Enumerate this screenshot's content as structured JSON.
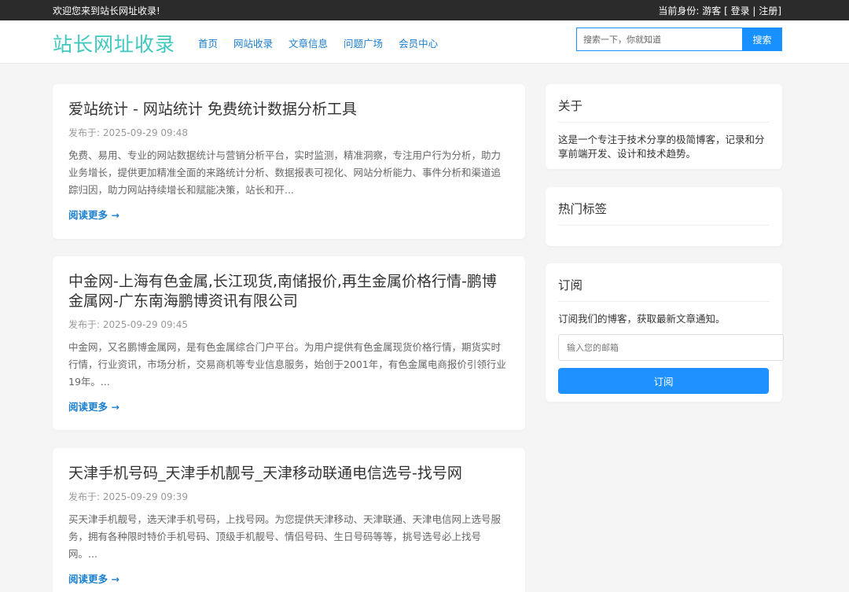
{
  "topbar": {
    "welcome": "欢迎您来到站长网址收录!",
    "identity_label": "当前身份: 游客 [",
    "login": "登录",
    "sep": "|",
    "register": "注册",
    "close": "]"
  },
  "header": {
    "logo": "站长网址收录",
    "nav": [
      "首页",
      "网站收录",
      "文章信息",
      "问题广场",
      "会员中心"
    ],
    "search_placeholder": "搜索一下，你就知道",
    "search_button": "搜索"
  },
  "posts": [
    {
      "title": "爱站统计 - 网站统计 免费统计数据分析工具",
      "date": "发布于: 2025-09-29 09:48",
      "excerpt": "免费、易用、专业的网站数据统计与营销分析平台，实时监测，精准洞察，专注用户行为分析，助力业务增长，提供更加精准全面的来路统计分析、数据报表可视化、网站分析能力、事件分析和渠道追踪归因，助力网站持续增长和赋能决策，站长和开...",
      "more": "阅读更多 →"
    },
    {
      "title": "中金网-上海有色金属,长江现货,南储报价,再生金属价格行情-鹏博金属网-广东南海鹏博资讯有限公司",
      "date": "发布于: 2025-09-29 09:45",
      "excerpt": "中金网，又名鹏博金属网，是有色金属综合门户平台。为用户提供有色金属现货价格行情，期货实时行情，行业资讯，市场分析，交易商机等专业信息服务，始创于2001年，有色金属电商报价引领行业19年。...",
      "more": "阅读更多 →"
    },
    {
      "title": "天津手机号码_天津手机靓号_天津移动联通电信选号-找号网",
      "date": "发布于: 2025-09-29 09:39",
      "excerpt": "买天津手机靓号，选天津手机号码，上找号网。为您提供天津移动、天津联通、天津电信网上选号服务，拥有各种限时特价手机号码、顶级手机靓号、情侣号码、生日号码等等，挑号选号必上找号网。...",
      "more": "阅读更多 →"
    }
  ],
  "sidebar": {
    "about_title": "关于",
    "about_text": "这是一个专注于技术分享的极简博客，记录和分享前端开发、设计和技术趋势。",
    "tags_title": "热门标签",
    "subscribe_title": "订阅",
    "subscribe_text": "订阅我们的博客，获取最新文章通知。",
    "email_placeholder": "输入您的邮箱",
    "subscribe_button": "订阅"
  }
}
